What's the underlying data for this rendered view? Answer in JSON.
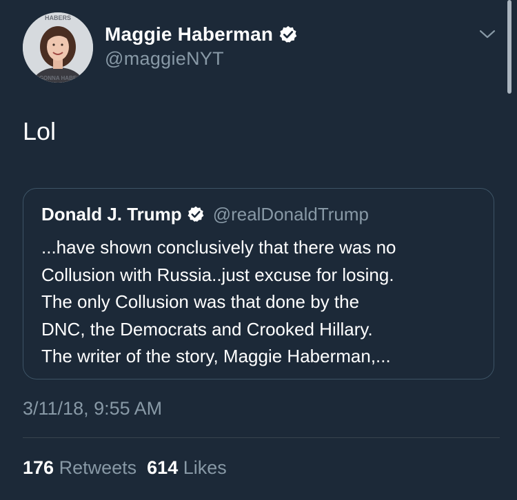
{
  "author": {
    "display_name": "Maggie Haberman",
    "handle": "@maggieNYT",
    "verified_icon": "verified-badge-icon",
    "avatar_top_text": "HABERS",
    "avatar_bottom_text": "GONNA HABE"
  },
  "menu": {
    "icon": "chevron-down-icon"
  },
  "tweet": {
    "text": "Lol",
    "timestamp": "3/11/18, 9:55 AM"
  },
  "quoted_tweet": {
    "display_name": "Donald J. Trump",
    "handle": "@realDonaldTrump",
    "verified_icon": "verified-badge-icon",
    "lines": [
      "...have shown conclusively that there was no",
      "Collusion with Russia..just excuse for losing.",
      "The only Collusion was that done by the",
      "DNC, the Democrats and Crooked Hillary.",
      "The writer of the story, Maggie Haberman,..."
    ]
  },
  "stats": {
    "retweets_count": "176",
    "retweets_label": "Retweets",
    "likes_count": "614",
    "likes_label": "Likes"
  },
  "colors": {
    "background": "#1c2938",
    "secondary_text": "#8899a6",
    "border": "#3d5466"
  }
}
